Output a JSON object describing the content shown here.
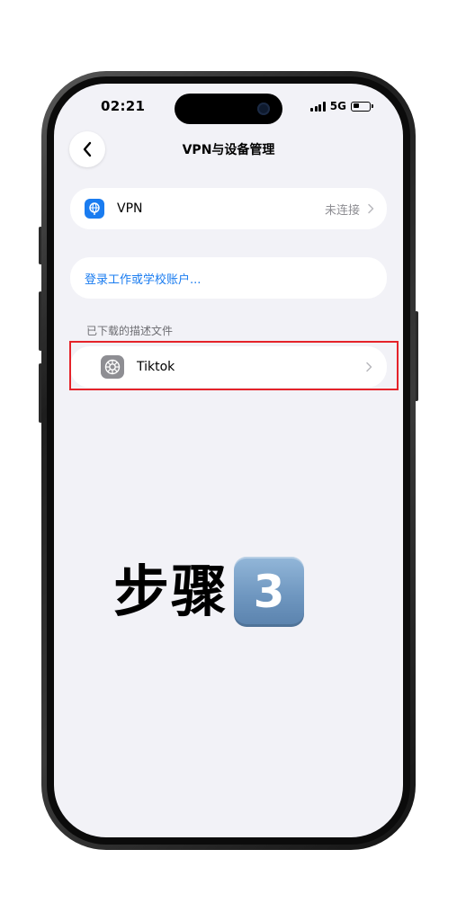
{
  "status_bar": {
    "time": "02:21",
    "network": "5G"
  },
  "nav": {
    "title": "VPN与设备管理"
  },
  "vpn_row": {
    "label": "VPN",
    "value": "未连接"
  },
  "login_row": {
    "label": "登录工作或学校账户..."
  },
  "profiles_section": {
    "header": "已下载的描述文件",
    "items": [
      {
        "label": "Tiktok"
      }
    ]
  },
  "overlay": {
    "step_text": "步骤",
    "step_number": "3"
  },
  "colors": {
    "accent": "#1a7cf0",
    "highlight": "#e5232a",
    "background": "#f2f2f7"
  },
  "icons": {
    "back": "chevron-left-icon",
    "vpn": "globe-icon",
    "profile": "gear-icon",
    "signal": "signal-icon",
    "battery": "battery-icon"
  }
}
